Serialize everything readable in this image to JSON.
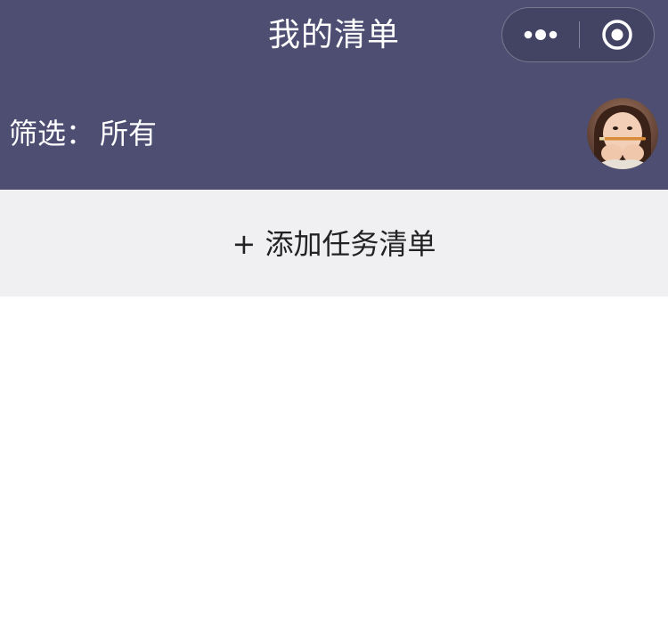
{
  "nav": {
    "title": "我的清单"
  },
  "capsule": {
    "more_icon": "more-dots-icon",
    "close_icon": "target-circle-icon"
  },
  "filter": {
    "label": "筛选：",
    "value": "所有"
  },
  "user": {
    "avatar": "user-avatar-photo"
  },
  "actions": {
    "add_list_label": "+ 添加任务清单"
  },
  "colors": {
    "header_bg": "#4d4e72",
    "add_bar_bg": "#f0eff2",
    "page_bg": "#ffffff"
  }
}
